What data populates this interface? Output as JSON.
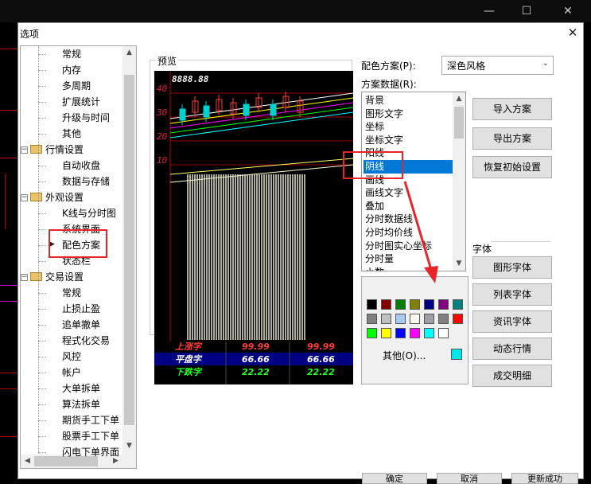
{
  "dialog": {
    "title": "选项"
  },
  "tree": {
    "items": [
      {
        "label": "常规",
        "level": 2
      },
      {
        "label": "内存",
        "level": 2
      },
      {
        "label": "多周期",
        "level": 2
      },
      {
        "label": "扩展统计",
        "level": 2
      },
      {
        "label": "升级与时间",
        "level": 2
      },
      {
        "label": "其他",
        "level": 2
      },
      {
        "label": "行情设置",
        "level": 1
      },
      {
        "label": "自动收盘",
        "level": 2
      },
      {
        "label": "数据与存储",
        "level": 2
      },
      {
        "label": "外观设置",
        "level": 1
      },
      {
        "label": "K线与分时图",
        "level": 2
      },
      {
        "label": "系统界面",
        "level": 2
      },
      {
        "label": "配色方案",
        "level": 2
      },
      {
        "label": "状态栏",
        "level": 2
      },
      {
        "label": "交易设置",
        "level": 1
      },
      {
        "label": "常规",
        "level": 2
      },
      {
        "label": "止损止盈",
        "level": 2
      },
      {
        "label": "追单撤单",
        "level": 2
      },
      {
        "label": "程式化交易",
        "level": 2
      },
      {
        "label": "风控",
        "level": 2
      },
      {
        "label": "帐户",
        "level": 2
      },
      {
        "label": "大单拆单",
        "level": 2
      },
      {
        "label": "算法拆单",
        "level": 2
      },
      {
        "label": "期货手工下单",
        "level": 2
      },
      {
        "label": "股票手工下单",
        "level": 2
      },
      {
        "label": "闪电下单界面",
        "level": 2
      }
    ]
  },
  "preview": {
    "label": "预览",
    "price_readout": "8888.88",
    "axis_labels": [
      "40",
      "30",
      "20",
      "10"
    ],
    "table": [
      {
        "label": "上涨字",
        "v1": "99.99",
        "v2": "99.99",
        "color": "#ff3b3b"
      },
      {
        "label": "平盘字",
        "v1": "66.66",
        "v2": "66.66",
        "color": "#ffffff"
      },
      {
        "label": "下跌字",
        "v1": "22.22",
        "v2": "22.22",
        "color": "#22ff22"
      }
    ]
  },
  "scheme": {
    "label": "配色方案(P):",
    "selected": "深色风格"
  },
  "scheme_data": {
    "label": "方案数据(R):",
    "items": [
      "背景",
      "图形文字",
      "坐标",
      "坐标文字",
      "阳线",
      "阴线",
      "画线",
      "画线文字",
      "叠加",
      "分时数据线",
      "分时均价线",
      "分时图实心坐标",
      "分时量",
      "小数"
    ],
    "selected_index": 5
  },
  "buttons": {
    "import": "导入方案",
    "export": "导出方案",
    "restore": "恢复初始设置"
  },
  "font_group": {
    "label": "字体",
    "buttons": [
      "图形字体",
      "列表字体",
      "资讯字体",
      "动态行情",
      "成交明细"
    ]
  },
  "palette": {
    "colors": [
      "#000000",
      "#800000",
      "#008000",
      "#808000",
      "#000080",
      "#800080",
      "#008080",
      "#808080",
      "#c0c0c0",
      "#a6caf0",
      "#fffbf0",
      "#a0a0a4",
      "#808080",
      "#ff0000",
      "#00ff00",
      "#ffff00",
      "#0000ff",
      "#ff00ff",
      "#00ffff",
      "#ffffff"
    ],
    "other_label": "其他(O)...",
    "current_color": "#00e5e5"
  },
  "bottom": {
    "ok": "确定",
    "cancel": "取消",
    "apply": "更新成功"
  }
}
